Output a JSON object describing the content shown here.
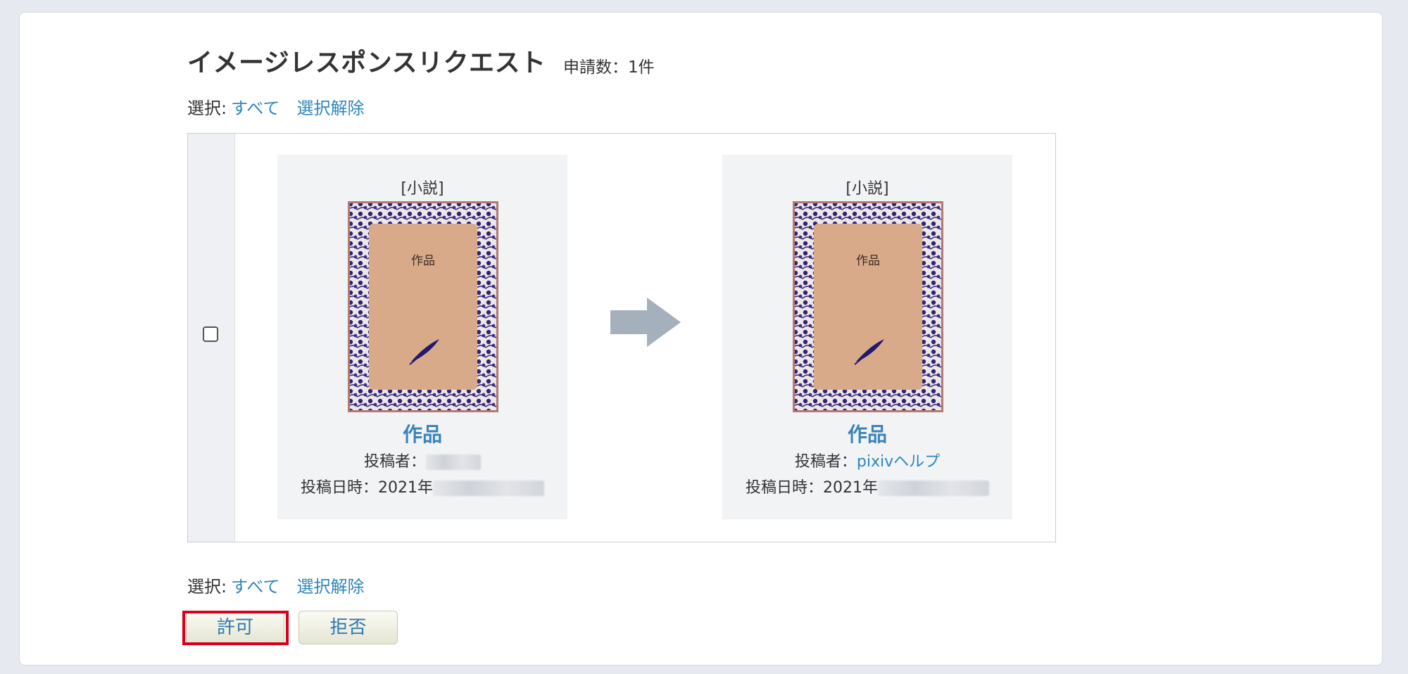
{
  "header": {
    "title": "イメージレスポンスリクエスト",
    "count_label": "申請数：1件"
  },
  "selection": {
    "label": "選択:",
    "all": "すべて",
    "clear": "選択解除"
  },
  "request": {
    "original": {
      "kind": "[小説]",
      "cover_text": "作品",
      "title": "作品",
      "poster_label": "投稿者：",
      "poster_name": "",
      "posted_label": "投稿日時：2021年"
    },
    "response": {
      "kind": "[小説]",
      "cover_text": "作品",
      "title": "作品",
      "poster_label": "投稿者：",
      "poster_name": "pixivヘルプ",
      "posted_label": "投稿日時：2021年"
    }
  },
  "actions": {
    "allow": "許可",
    "deny": "拒否"
  },
  "colors": {
    "link": "#2e86bd",
    "title_link": "#3b84b8",
    "highlight": "#d9001b",
    "cover_border": "#3b2f7a",
    "cover_inner": "#d9aa8a"
  }
}
